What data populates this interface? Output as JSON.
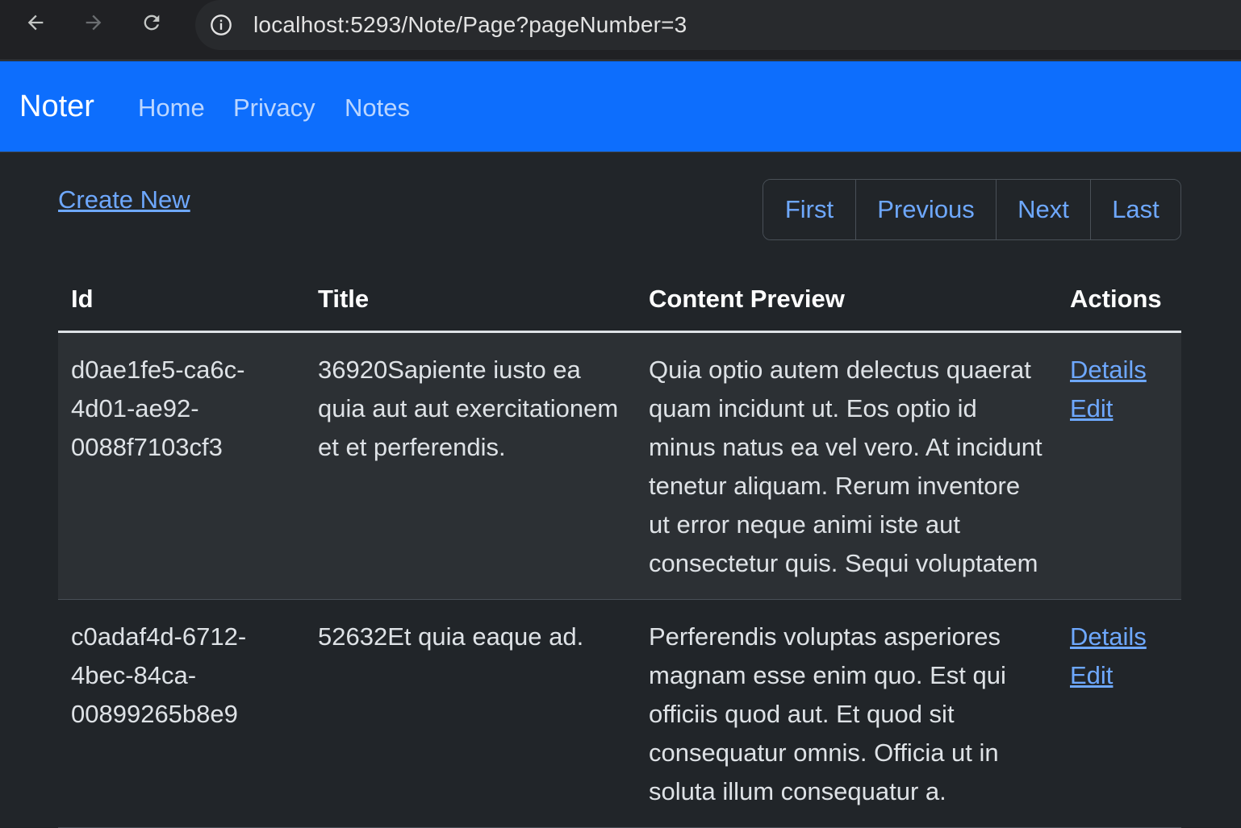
{
  "browser": {
    "url": "localhost:5293/Note/Page?pageNumber=3"
  },
  "navbar": {
    "brand": "Noter",
    "links": [
      "Home",
      "Privacy",
      "Notes"
    ]
  },
  "main": {
    "create_new": "Create New",
    "pagination": [
      "First",
      "Previous",
      "Next",
      "Last"
    ],
    "table": {
      "headers": [
        "Id",
        "Title",
        "Content Preview",
        "Actions"
      ],
      "rows": [
        {
          "id": "d0ae1fe5-ca6c-4d01-ae92-0088f7103cf3",
          "title": "36920Sapiente iusto ea quia aut aut exercitationem et et perferendis.",
          "preview": "Quia optio autem delectus quaerat quam incidunt ut. Eos optio id minus natus ea vel vero. At incidunt tenetur aliquam. Rerum inventore ut error neque animi iste aut consectetur quis. Sequi voluptatem",
          "details": "Details",
          "edit": "Edit"
        },
        {
          "id": "c0adaf4d-6712-4bec-84ca-00899265b8e9",
          "title": "52632Et quia eaque ad.",
          "preview": "Perferendis voluptas asperiores magnam esse enim quo. Est qui officiis quod aut. Et quod sit consequatur omnis. Officia ut in soluta illum consequatur a.",
          "details": "Details",
          "edit": "Edit"
        }
      ]
    }
  }
}
